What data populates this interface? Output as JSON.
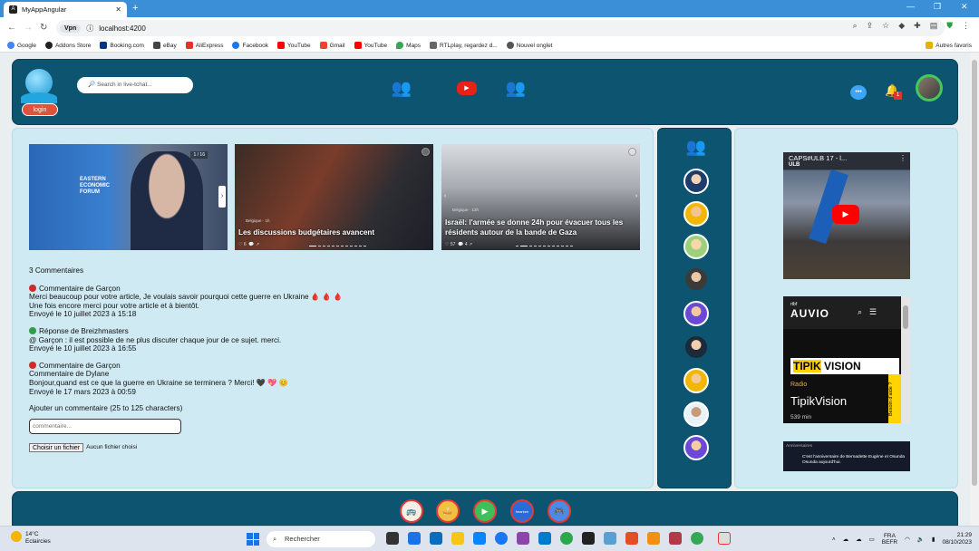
{
  "browser": {
    "tab_title": "MyAppAngular",
    "url": "localhost:4200",
    "url_chip": "Vpn",
    "bookmarks": [
      "Google",
      "Addons Store",
      "Booking.com",
      "eBay",
      "AliExpress",
      "Facebook",
      "YouTube",
      "Gmail",
      "YouTube",
      "Maps",
      "RTLplay, regardez d...",
      "Nouvel onglet"
    ],
    "other_bookmarks": "Autres favoris"
  },
  "header": {
    "login_label": "login",
    "search_placeholder": "Search in live-tchat...",
    "notification_badge": "1",
    "youtube_label": "▶"
  },
  "news": [
    {
      "title": "",
      "counter": "1 / 16"
    },
    {
      "title": "Les discussions budgétaires avancent",
      "category": "Belgique · 1h"
    },
    {
      "title": "Israël: l'armée se donne 24h pour évacuer tous les résidents autour de la bande de Gaza",
      "category": "Belgique · 12h"
    }
  ],
  "comments": {
    "count_label": "3 Commentaires",
    "items": [
      {
        "author": "Commentaire de Garçon",
        "lines": [
          "Merci beaucoup pour votre article, Je voulais savoir pourquoi cette guerre en Ukraine 🩸 🩸 🩸",
          "Une fois encore merci pour votre article et à bientôt."
        ],
        "date": "Envoyé le 10 juillet 2023 à 15:18",
        "color": "#d02b2b"
      },
      {
        "author": "Réponse de Breizhmasters",
        "lines": [
          "@ Garçon : il est possible de ne plus discuter chaque jour de ce sujet. merci."
        ],
        "date": "Envoyé le 10 juillet 2023 à 16:55",
        "color": "#2f9e44"
      },
      {
        "author": "Commentaire de Garçon",
        "lines": [
          "Commentaire de Dylane",
          "Bonjour,quand est ce que la guerre en Ukraine se terminera ? Merci! 🖤 💖 😊"
        ],
        "date": "Envoyé le 17 mars 2023 à 00:59",
        "color": "#d02b2b"
      }
    ],
    "add_label": "Ajouter un commentaire (25 to 125 characters)",
    "input_placeholder": "commentaire...",
    "file_button": "Choisir un fichier",
    "file_status": "Aucun fichier choisi"
  },
  "sidebar_media": {
    "video_title": "CAPS#ULB 17 - l...",
    "video_channel": "ULB",
    "auvio_logo": "AUVIO",
    "auvio_brand": "rtbf",
    "tipik_word1": "TIPIK",
    "tipik_word2": "VISION",
    "radio_label": "Radio",
    "program_name": "TipikVision",
    "duration": "539 min",
    "aide_label": "Besoin d'aide ?",
    "anniv_title": "Anniversaires",
    "anniv_text": "C'est l'anniversaire de Bernadette Eugène et Osunda Osunda aujourd'hui."
  },
  "taskbar": {
    "temperature": "14°C",
    "weather": "Eclaircies",
    "search_label": "Rechercher",
    "lang1": "FRA",
    "lang2": "BEFR",
    "time": "21:29",
    "date": "08/10/2023"
  }
}
